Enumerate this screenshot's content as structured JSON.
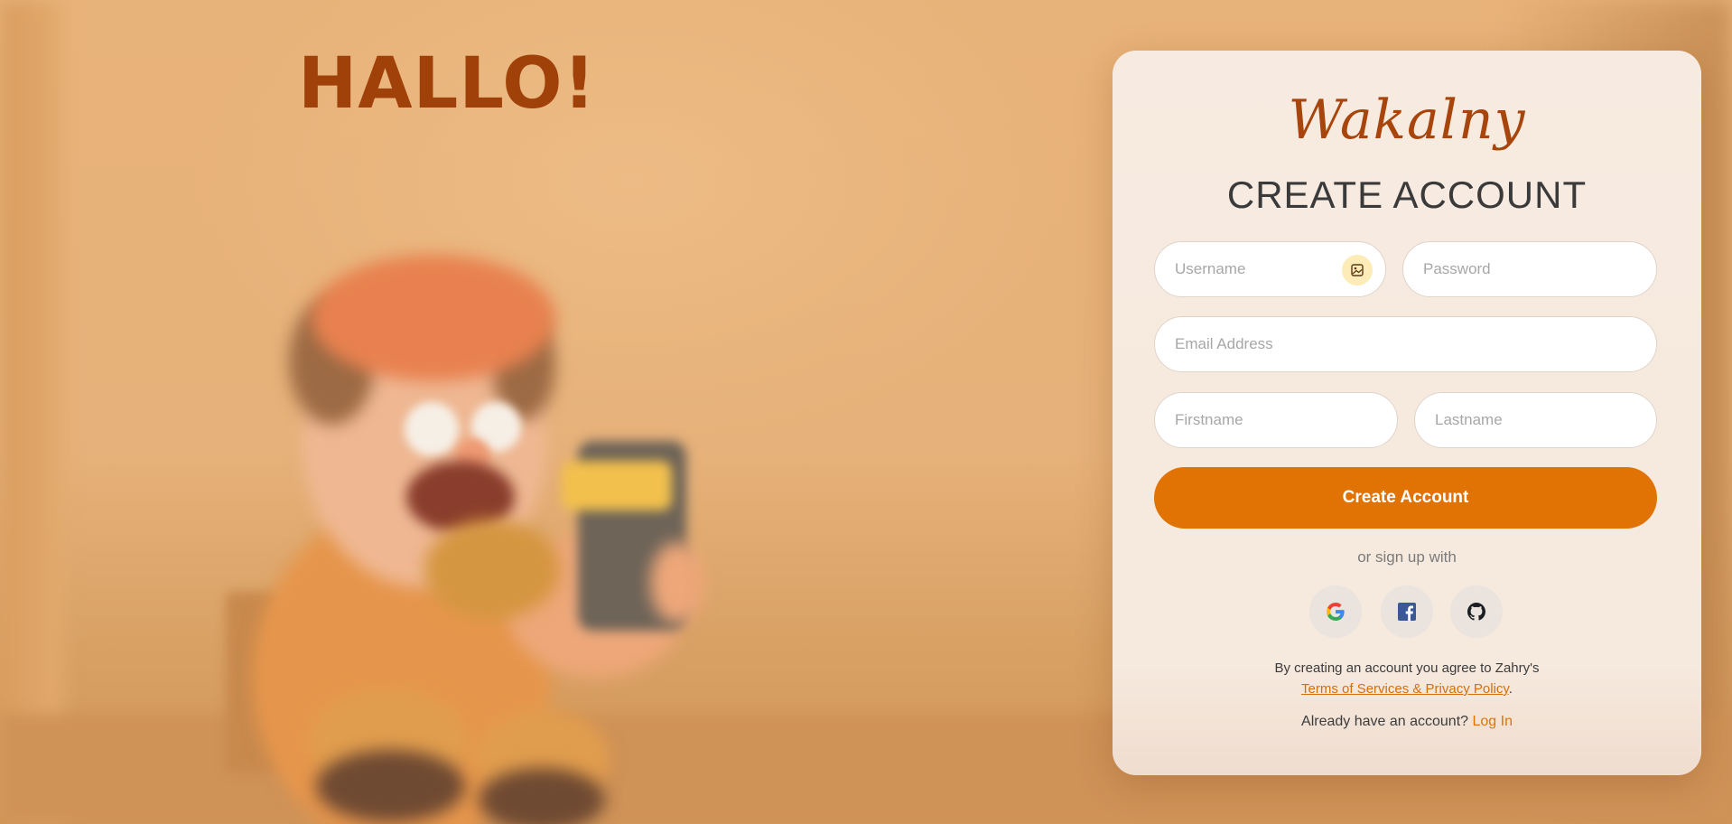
{
  "hero": {
    "greeting": "HALLO!"
  },
  "card": {
    "brand": "Wakalny",
    "title": "CREATE ACCOUNT",
    "fields": {
      "username_placeholder": "Username",
      "password_placeholder": "Password",
      "email_placeholder": "Email Address",
      "firstname_placeholder": "Firstname",
      "lastname_placeholder": "Lastname"
    },
    "upload_icon": "image-upload-icon",
    "submit_label": "Create Account",
    "divider_text": "or sign up with",
    "social": [
      {
        "name": "google-icon"
      },
      {
        "name": "facebook-icon"
      },
      {
        "name": "github-icon"
      }
    ],
    "terms_prefix": "By creating an account you agree to Zahry's",
    "terms_link": "Terms of Services & Privacy Policy",
    "terms_suffix": ".",
    "login_prompt": "Already have an account?",
    "login_link": "Log In"
  },
  "colors": {
    "accent": "#e07303",
    "heading": "#a0410a",
    "brand": "#a8450c",
    "background": "#e3ab6e"
  }
}
